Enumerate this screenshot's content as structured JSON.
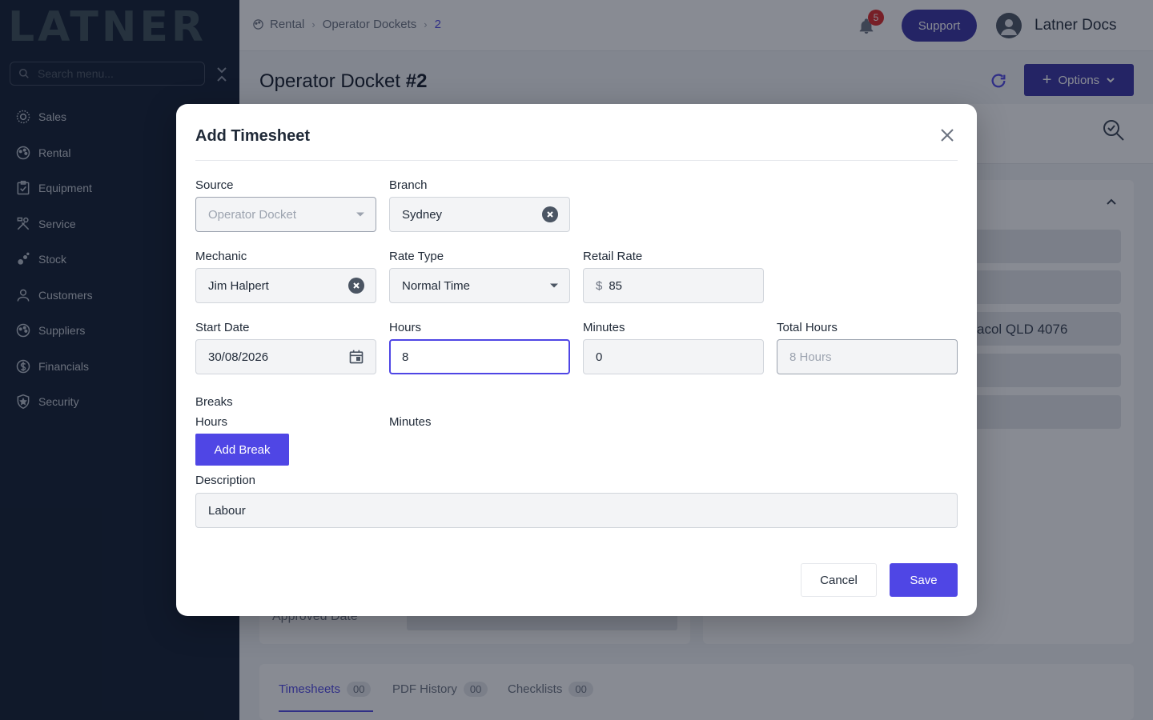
{
  "sidebar": {
    "logo": "LATNER",
    "search_placeholder": "Search menu...",
    "items": [
      {
        "label": "Sales",
        "icon": "sun-icon"
      },
      {
        "label": "Rental",
        "icon": "palette-icon"
      },
      {
        "label": "Equipment",
        "icon": "clipboard-icon"
      },
      {
        "label": "Service",
        "icon": "tools-icon"
      },
      {
        "label": "Stock",
        "icon": "boxes-icon"
      },
      {
        "label": "Customers",
        "icon": "user-icon"
      },
      {
        "label": "Suppliers",
        "icon": "palette-icon"
      },
      {
        "label": "Financials",
        "icon": "currency-icon"
      },
      {
        "label": "Security",
        "icon": "shield-icon"
      }
    ]
  },
  "header": {
    "breadcrumb": [
      "Rental",
      "Operator Dockets",
      "2"
    ],
    "notification_count": "5",
    "support_label": "Support",
    "user_name": "Latner Docs"
  },
  "page": {
    "title": "Operator Docket",
    "number": "#2",
    "options_label": "Options",
    "background_address": "acol QLD 4076",
    "approved_date_label": "Approved Date",
    "tabs": [
      {
        "label": "Timesheets",
        "count": "00"
      },
      {
        "label": "PDF History",
        "count": "00"
      },
      {
        "label": "Checklists",
        "count": "00"
      }
    ]
  },
  "modal": {
    "title": "Add Timesheet",
    "source": {
      "label": "Source",
      "value": "Operator Docket"
    },
    "branch": {
      "label": "Branch",
      "value": "Sydney"
    },
    "mechanic": {
      "label": "Mechanic",
      "value": "Jim Halpert"
    },
    "rate_type": {
      "label": "Rate Type",
      "value": "Normal Time"
    },
    "retail_rate": {
      "label": "Retail Rate",
      "currency": "$",
      "value": "85"
    },
    "start_date": {
      "label": "Start Date",
      "value": "30/08/2026"
    },
    "hours": {
      "label": "Hours",
      "value": "8"
    },
    "minutes": {
      "label": "Minutes",
      "value": "0"
    },
    "total_hours": {
      "label": "Total Hours",
      "value": "8 Hours"
    },
    "breaks": {
      "label": "Breaks",
      "hours_label": "Hours",
      "minutes_label": "Minutes",
      "add_label": "Add Break"
    },
    "description": {
      "label": "Description",
      "value": "Labour"
    },
    "cancel_label": "Cancel",
    "save_label": "Save"
  },
  "colors": {
    "accent": "#4f46e5",
    "sidebar_bg": "#0e1b2e",
    "badge": "#dc2626"
  }
}
